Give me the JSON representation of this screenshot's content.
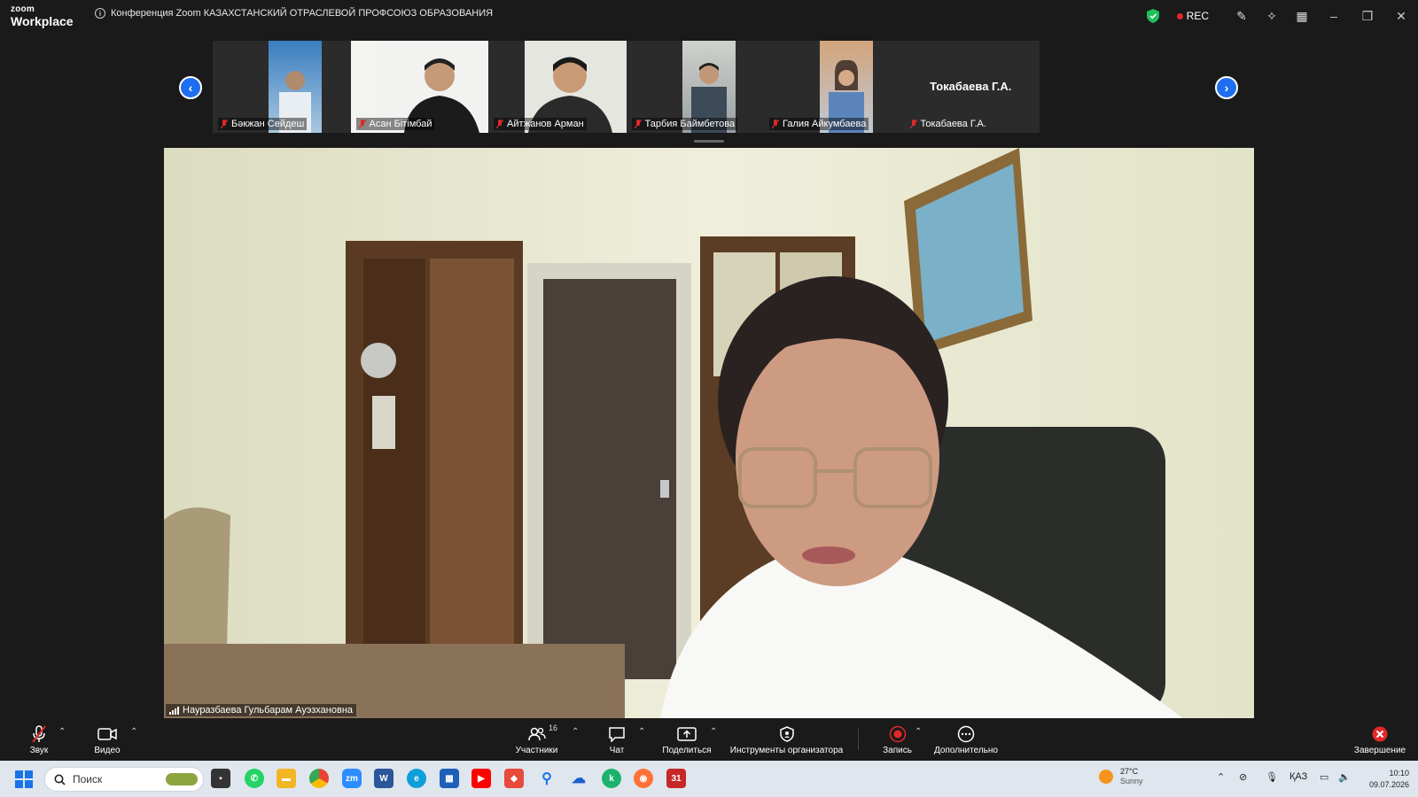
{
  "app": {
    "logo_small": "zoom",
    "logo_big": "Workplace",
    "meeting_title": "Конференция Zoom КАЗАХСТАНСКИЙ ОТРАСЛЕВОЙ ПРОФСОЮЗ ОБРАЗОВАНИЯ",
    "rec_label": "REC"
  },
  "participants": [
    {
      "name": "Бәкжан Сейдеш",
      "muted": true
    },
    {
      "name": "Асан Бітімбай",
      "muted": true
    },
    {
      "name": "Айтжанов Арман",
      "muted": true
    },
    {
      "name": "Тарбия Баймбетова",
      "muted": true
    },
    {
      "name": "Галия Айкумбаева",
      "muted": true
    },
    {
      "name": "Токабаева Г.А.",
      "muted": true,
      "display_name": "Токабаева Г.А."
    }
  ],
  "speaker": {
    "name": "Науразбаева Гульбарам Ауэзхановна"
  },
  "toolbar": {
    "audio": "Звук",
    "video": "Видео",
    "participants": "Участники",
    "participants_count": "16",
    "chat": "Чат",
    "share": "Поделиться",
    "host_tools": "Инструменты организатора",
    "record": "Запись",
    "more": "Дополнительно",
    "end": "Завершение"
  },
  "taskbar": {
    "search_placeholder": "Поиск",
    "weather_temp": "27°C",
    "weather_desc": "Sunny",
    "language": "ҚАЗ",
    "time": "10:10",
    "date": "09.07.2026"
  },
  "colors": {
    "accent": "#1e6ef0",
    "rec_red": "#e02828",
    "end_red": "#e02828",
    "shield_green": "#1fbf5a"
  }
}
